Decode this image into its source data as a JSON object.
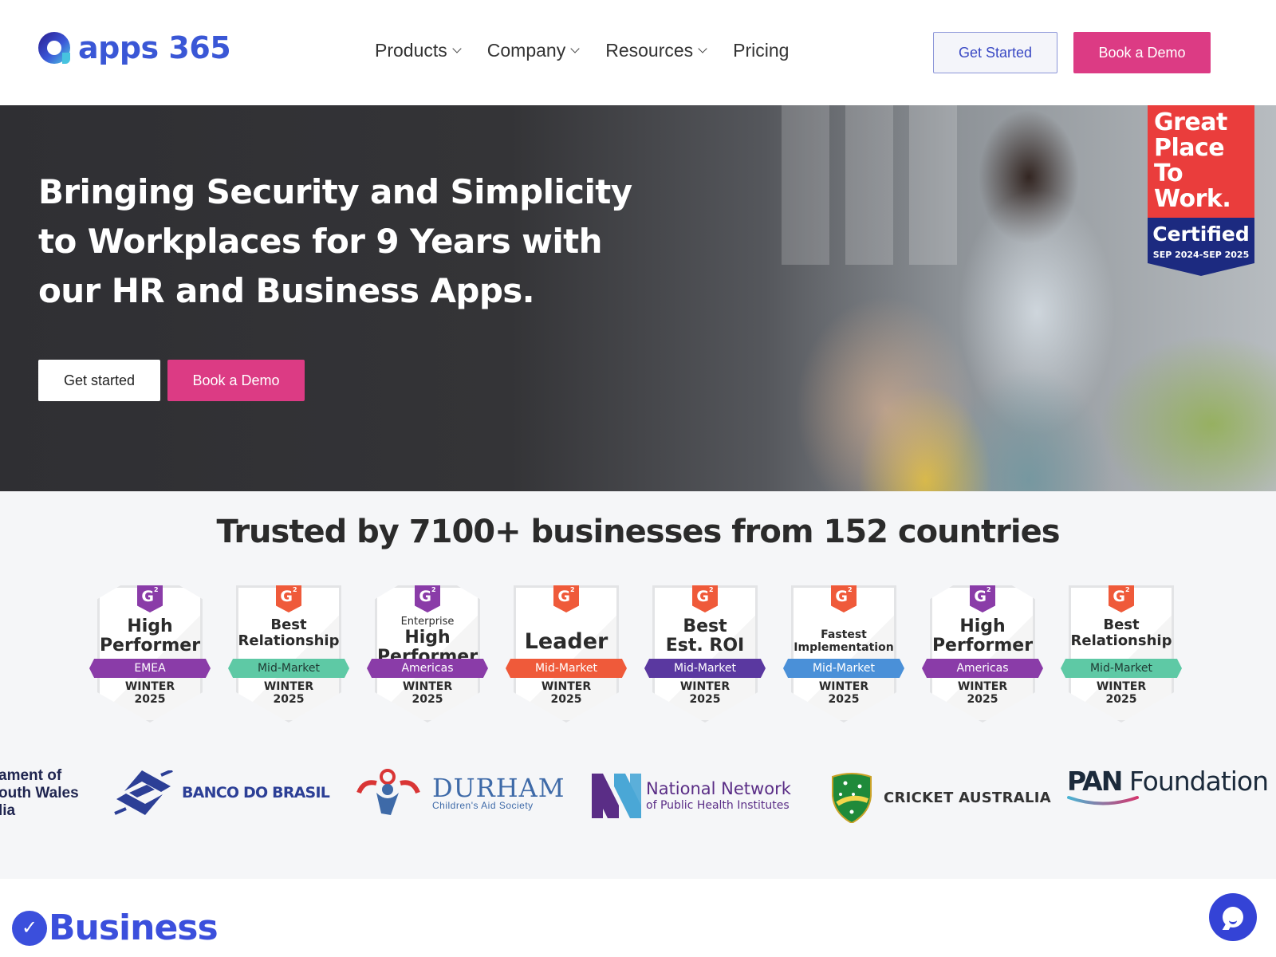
{
  "header": {
    "logo_text": "apps 365",
    "nav": [
      {
        "label": "Products",
        "has_dropdown": true
      },
      {
        "label": "Company",
        "has_dropdown": true
      },
      {
        "label": "Resources",
        "has_dropdown": true
      },
      {
        "label": "Pricing",
        "has_dropdown": false
      }
    ],
    "get_started_label": "Get Started",
    "book_demo_label": "Book a Demo"
  },
  "hero": {
    "title": "Bringing Security and Simplicity to Workplaces for 9 Years with our HR and Business Apps.",
    "get_started_label": "Get started",
    "book_demo_label": "Book a Demo",
    "certification": {
      "line1": "Great",
      "line2": "Place",
      "line3": "To",
      "line4": "Work.",
      "certified": "Certified",
      "period": "SEP 2024-SEP 2025"
    }
  },
  "trusted": {
    "title": "Trusted by 7100+ businesses from 152 countries",
    "badges": [
      {
        "pre": "",
        "title_line1": "High",
        "title_line2": "Performer",
        "ribbon": "EMEA",
        "season": "WINTER",
        "year": "2025",
        "g2_color": "#8a3ca8",
        "ribbon_color": "#8a3ca8",
        "ribbon_text_color": "#ffffff",
        "shape": "hex"
      },
      {
        "pre": "",
        "title_line1": "Best",
        "title_line2": "Relationship",
        "ribbon": "Mid-Market",
        "season": "WINTER",
        "year": "2025",
        "g2_color": "#ef5a3a",
        "ribbon_color": "#5ec9a5",
        "ribbon_text_color": "#1f3a33",
        "shape": "square"
      },
      {
        "pre": "Enterprise",
        "title_line1": "High",
        "title_line2": "Performer",
        "ribbon": "Americas",
        "season": "WINTER",
        "year": "2025",
        "g2_color": "#8a3ca8",
        "ribbon_color": "#8a3ca8",
        "ribbon_text_color": "#ffffff",
        "shape": "hex"
      },
      {
        "pre": "",
        "title_line1": "Leader",
        "title_line2": "",
        "ribbon": "Mid-Market",
        "season": "WINTER",
        "year": "2025",
        "g2_color": "#ef5a3a",
        "ribbon_color": "#ef5a3a",
        "ribbon_text_color": "#ffffff",
        "shape": "square"
      },
      {
        "pre": "",
        "title_line1": "Best",
        "title_line2": "Est. ROI",
        "ribbon": "Mid-Market",
        "season": "WINTER",
        "year": "2025",
        "g2_color": "#ef5a3a",
        "ribbon_color": "#5a38a0",
        "ribbon_text_color": "#ffffff",
        "shape": "square"
      },
      {
        "pre": "",
        "title_line1": "Fastest",
        "title_line2": "Implementation",
        "ribbon": "Mid-Market",
        "season": "WINTER",
        "year": "2025",
        "g2_color": "#ef5a3a",
        "ribbon_color": "#4a90d8",
        "ribbon_text_color": "#ffffff",
        "shape": "square"
      },
      {
        "pre": "",
        "title_line1": "High",
        "title_line2": "Performer",
        "ribbon": "Americas",
        "season": "WINTER",
        "year": "2025",
        "g2_color": "#8a3ca8",
        "ribbon_color": "#8a3ca8",
        "ribbon_text_color": "#ffffff",
        "shape": "hex"
      },
      {
        "pre": "",
        "title_line1": "Best",
        "title_line2": "Relationship",
        "ribbon": "Mid-Market",
        "season": "WINTER",
        "year": "2025",
        "g2_color": "#ef5a3a",
        "ribbon_color": "#5ec9a5",
        "ribbon_text_color": "#1f3a33",
        "shape": "square"
      }
    ],
    "customer_logos": {
      "nsw": [
        "ament of",
        "outh Wales",
        "lia"
      ],
      "banco": "BANCO DO BRASIL",
      "durham_title": "DURHAM",
      "durham_sub": "Children's Aid Society",
      "nn_title": "National Network",
      "nn_sub": "of Public Health Institutes",
      "cricket": "CRICKET AUSTRALIA",
      "pan_bold": "PAN",
      "pan_rest": " Foundation"
    }
  },
  "bottom": {
    "section_title": "Business"
  },
  "colors": {
    "brand_blue": "#3a57d6",
    "accent_pink": "#dc3b84",
    "chat_blue": "#3443d6"
  }
}
